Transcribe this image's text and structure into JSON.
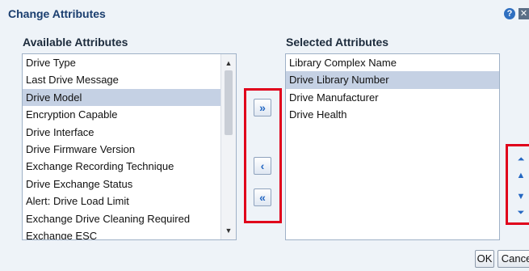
{
  "dialog": {
    "title": "Change Attributes",
    "help_glyph": "?",
    "close_glyph": "✕"
  },
  "available": {
    "label": "Available Attributes",
    "items": [
      {
        "label": "Drive Type",
        "selected": false
      },
      {
        "label": "Last Drive Message",
        "selected": false
      },
      {
        "label": "Drive Model",
        "selected": true
      },
      {
        "label": "Encryption Capable",
        "selected": false
      },
      {
        "label": "Drive Interface",
        "selected": false
      },
      {
        "label": "Drive Firmware Version",
        "selected": false
      },
      {
        "label": "Exchange Recording Technique",
        "selected": false
      },
      {
        "label": "Drive Exchange Status",
        "selected": false
      },
      {
        "label": "Alert: Drive Load Limit",
        "selected": false
      },
      {
        "label": "Exchange Drive Cleaning Required",
        "selected": false
      },
      {
        "label": "Exchange ESC",
        "selected": false
      }
    ]
  },
  "selected": {
    "label": "Selected Attributes",
    "items": [
      {
        "label": "Library Complex Name",
        "selected": false
      },
      {
        "label": "Drive Library Number",
        "selected": true
      },
      {
        "label": "Drive Manufacturer",
        "selected": false
      },
      {
        "label": "Drive Health",
        "selected": false
      }
    ]
  },
  "shuttle": {
    "move_all_right_glyph": "»",
    "move_left_glyph": "‹",
    "move_all_left_glyph": "«"
  },
  "reorder": {
    "top_glyph": "⏶",
    "up_glyph": "▲",
    "down_glyph": "▼",
    "bottom_glyph": "⏷"
  },
  "scroll": {
    "up_glyph": "▲",
    "down_glyph": "▼"
  },
  "buttons": {
    "ok": "OK",
    "cancel": "Cancel"
  },
  "colors": {
    "highlight_box": "#e0001b",
    "selection": "#c5d1e4",
    "title": "#1a3e6f"
  }
}
